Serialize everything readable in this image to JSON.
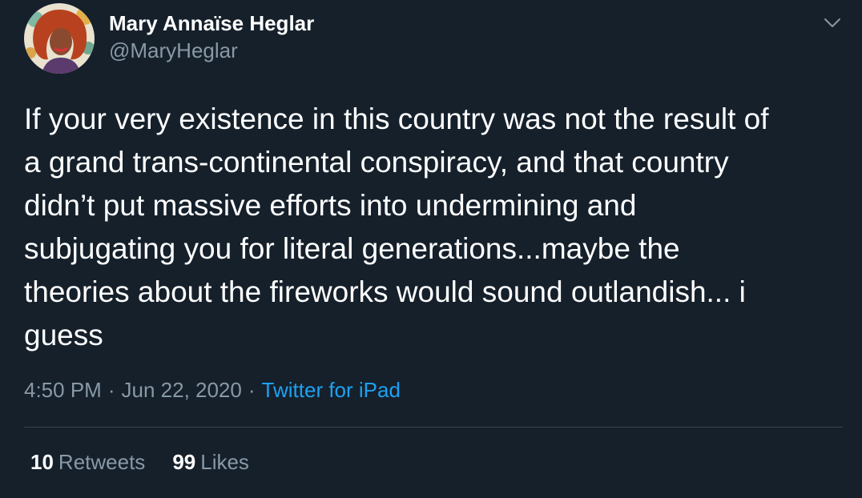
{
  "colors": {
    "background": "#15202b",
    "text_primary": "#ffffff",
    "text_secondary": "#8899a6",
    "link": "#1da1f2",
    "divider": "#38444d"
  },
  "author": {
    "name": "Mary Annaïse Heglar",
    "handle": "@MaryHeglar",
    "avatar_icon": "avatar-illustration"
  },
  "menu": {
    "icon": "chevron-down-icon"
  },
  "tweet": {
    "lines": [
      "If your very existence in this country was not the result of",
      "a grand trans-continental conspiracy, and that country",
      "didn’t put massive efforts into undermining and",
      "subjugating you for literal generations...maybe the",
      "theories about the fireworks would sound outlandish... i",
      "guess"
    ]
  },
  "meta": {
    "time": "4:50 PM",
    "separator": "·",
    "date": "Jun 22, 2020",
    "source": "Twitter for iPad"
  },
  "stats": {
    "retweets": {
      "count": "10",
      "label": "Retweets"
    },
    "likes": {
      "count": "99",
      "label": "Likes"
    }
  }
}
